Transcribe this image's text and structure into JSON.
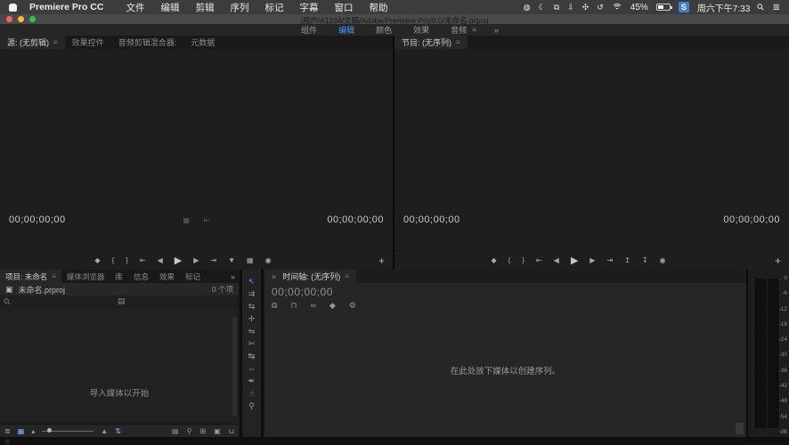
{
  "colors": {
    "accent_blue": "#4a9af0",
    "menu_bar_bg": "#3c3c3c",
    "panel_bg": "#1e1e1e",
    "traffic_red": "#ff5f57",
    "traffic_yellow": "#febc2e",
    "traffic_green": "#28c840"
  },
  "menu_bar": {
    "app_name": "Premiere Pro CC",
    "menus": [
      "文件",
      "编辑",
      "剪辑",
      "序列",
      "标记",
      "字幕",
      "窗口",
      "帮助"
    ],
    "status_icons": [
      {
        "name": "notification-icon",
        "glyph": "◍"
      },
      {
        "name": "moon-icon",
        "glyph": "☾"
      },
      {
        "name": "displays-icon",
        "glyph": "⧉"
      },
      {
        "name": "download-icon",
        "glyph": "⇩"
      },
      {
        "name": "fan-icon",
        "glyph": "✣"
      },
      {
        "name": "time-machine-icon",
        "glyph": "↺"
      }
    ],
    "battery_percent": "45%",
    "ime_label": "S",
    "clock": "周六下午7:33",
    "spotlight_glyph": "⚲",
    "control_center_glyph": "≣"
  },
  "title_bar": {
    "document_path": "/用户/A1234/文稿/Adobe/Premiere Pro/9.0/未命名.prproj"
  },
  "workspace_bar": {
    "tabs": [
      {
        "label": "组件"
      },
      {
        "label": "编辑",
        "active": true
      },
      {
        "label": "颜色"
      },
      {
        "label": "效果"
      },
      {
        "label": "音频"
      }
    ],
    "menu_glyph": "≡",
    "overflow": "»"
  },
  "source_monitor": {
    "tabs": [
      {
        "label": "源: (无剪辑)",
        "active": true
      },
      {
        "label": "效果控件"
      },
      {
        "label": "音频剪辑混合器:"
      },
      {
        "label": "元数据"
      }
    ],
    "panel_menu_glyph": "≡",
    "timecode_left": "00;00;00;00",
    "timecode_right": "00;00;00;00",
    "center_icons": [
      {
        "name": "zoom-level-icon",
        "glyph": "▦"
      },
      {
        "name": "resolution-icon",
        "glyph": "⇤"
      }
    ],
    "transport": [
      {
        "name": "add-marker-button",
        "glyph": "◆"
      },
      {
        "name": "mark-in-button",
        "glyph": "{"
      },
      {
        "name": "mark-out-button",
        "glyph": "}"
      },
      {
        "name": "goto-in-button",
        "glyph": "⇤"
      },
      {
        "name": "step-back-button",
        "glyph": "◀"
      },
      {
        "name": "play-button",
        "glyph": "▶",
        "big": true
      },
      {
        "name": "step-forward-button",
        "glyph": "▶"
      },
      {
        "name": "goto-out-button",
        "glyph": "⇥"
      },
      {
        "name": "insert-button",
        "glyph": "▼"
      },
      {
        "name": "overwrite-button",
        "glyph": "▦"
      },
      {
        "name": "export-frame-button",
        "glyph": "◉"
      }
    ],
    "add_button_label": "+"
  },
  "program_monitor": {
    "tabs": [
      {
        "label": "节目: (无序列)",
        "active": true
      }
    ],
    "panel_menu_glyph": "≡",
    "timecode_left": "00;00;00;00",
    "timecode_right": "00;00;00;00",
    "transport": [
      {
        "name": "add-marker-button",
        "glyph": "◆"
      },
      {
        "name": "mark-in-button",
        "glyph": "{"
      },
      {
        "name": "mark-out-button",
        "glyph": "}"
      },
      {
        "name": "goto-in-button",
        "glyph": "⇤"
      },
      {
        "name": "step-back-button",
        "glyph": "◀"
      },
      {
        "name": "play-button",
        "glyph": "▶",
        "big": true
      },
      {
        "name": "step-forward-button",
        "glyph": "▶"
      },
      {
        "name": "goto-out-button",
        "glyph": "⇥"
      },
      {
        "name": "lift-button",
        "glyph": "↥"
      },
      {
        "name": "extract-button",
        "glyph": "↧"
      },
      {
        "name": "export-frame-button",
        "glyph": "◉"
      }
    ],
    "add_button_label": "+"
  },
  "project_panel": {
    "tabs": [
      {
        "label": "项目: 未命名",
        "active": true
      },
      {
        "label": "媒体浏览器"
      },
      {
        "label": "库"
      },
      {
        "label": "信息"
      },
      {
        "label": "效果"
      },
      {
        "label": "标记"
      }
    ],
    "panel_menu_glyph": "≡",
    "overflow": "»",
    "file_icon_glyph": "▣",
    "file_name": "未命名.prproj",
    "item_count": "0 个项",
    "search_glyph": "⚲",
    "folder_glyph": "▤",
    "empty_text": "导入媒体以开始",
    "footer_left_icons": [
      {
        "name": "list-view-button",
        "glyph": "≣"
      },
      {
        "name": "icon-view-button",
        "glyph": "▦"
      },
      {
        "name": "zoom-out-icon",
        "glyph": "▴"
      }
    ],
    "footer_mid_icons": [
      {
        "name": "zoom-in-icon",
        "glyph": "▲"
      },
      {
        "name": "sort-button",
        "glyph": "⇅"
      }
    ],
    "footer_right_icons": [
      {
        "name": "automate-to-sequence-button",
        "glyph": "▤"
      },
      {
        "name": "find-button",
        "glyph": "⚲"
      },
      {
        "name": "new-bin-button",
        "glyph": "⊞"
      },
      {
        "name": "new-item-button",
        "glyph": "▣"
      },
      {
        "name": "clear-button",
        "glyph": "⊔"
      }
    ]
  },
  "tools": [
    {
      "name": "selection-tool",
      "glyph": "↖",
      "active": true
    },
    {
      "name": "track-select-forward-tool",
      "glyph": "⇉"
    },
    {
      "name": "ripple-edit-tool",
      "glyph": "⇆"
    },
    {
      "name": "rolling-edit-tool",
      "glyph": "✛"
    },
    {
      "name": "rate-stretch-tool",
      "glyph": "⇋"
    },
    {
      "name": "razor-tool",
      "glyph": "✂"
    },
    {
      "name": "slip-tool",
      "glyph": "↹"
    },
    {
      "name": "slide-tool",
      "glyph": "⇔"
    },
    {
      "name": "pen-tool",
      "glyph": "✒"
    },
    {
      "name": "hand-tool",
      "glyph": "☝"
    },
    {
      "name": "zoom-tool",
      "glyph": "⚲"
    }
  ],
  "timeline": {
    "close_glyph": "×",
    "tab_label": "时间轴: (无序列)",
    "panel_menu_glyph": "≡",
    "timecode": "00;00;00;00",
    "toolbar": [
      {
        "name": "nest-toggle-button",
        "glyph": "⧉"
      },
      {
        "name": "snap-button",
        "glyph": "⊓"
      },
      {
        "name": "linked-selection-button",
        "glyph": "∞"
      },
      {
        "name": "add-marker-button",
        "glyph": "◆"
      },
      {
        "name": "timeline-settings-button",
        "glyph": "⚙"
      }
    ],
    "empty_text": "在此处放下媒体以创建序列。"
  },
  "audio_meter": {
    "ticks": [
      "0",
      "-6",
      "-12",
      "-18",
      "-24",
      "-30",
      "-36",
      "-42",
      "-48",
      "-54",
      "dB"
    ]
  },
  "bottom_strip": {
    "status_glyph": "◎"
  }
}
